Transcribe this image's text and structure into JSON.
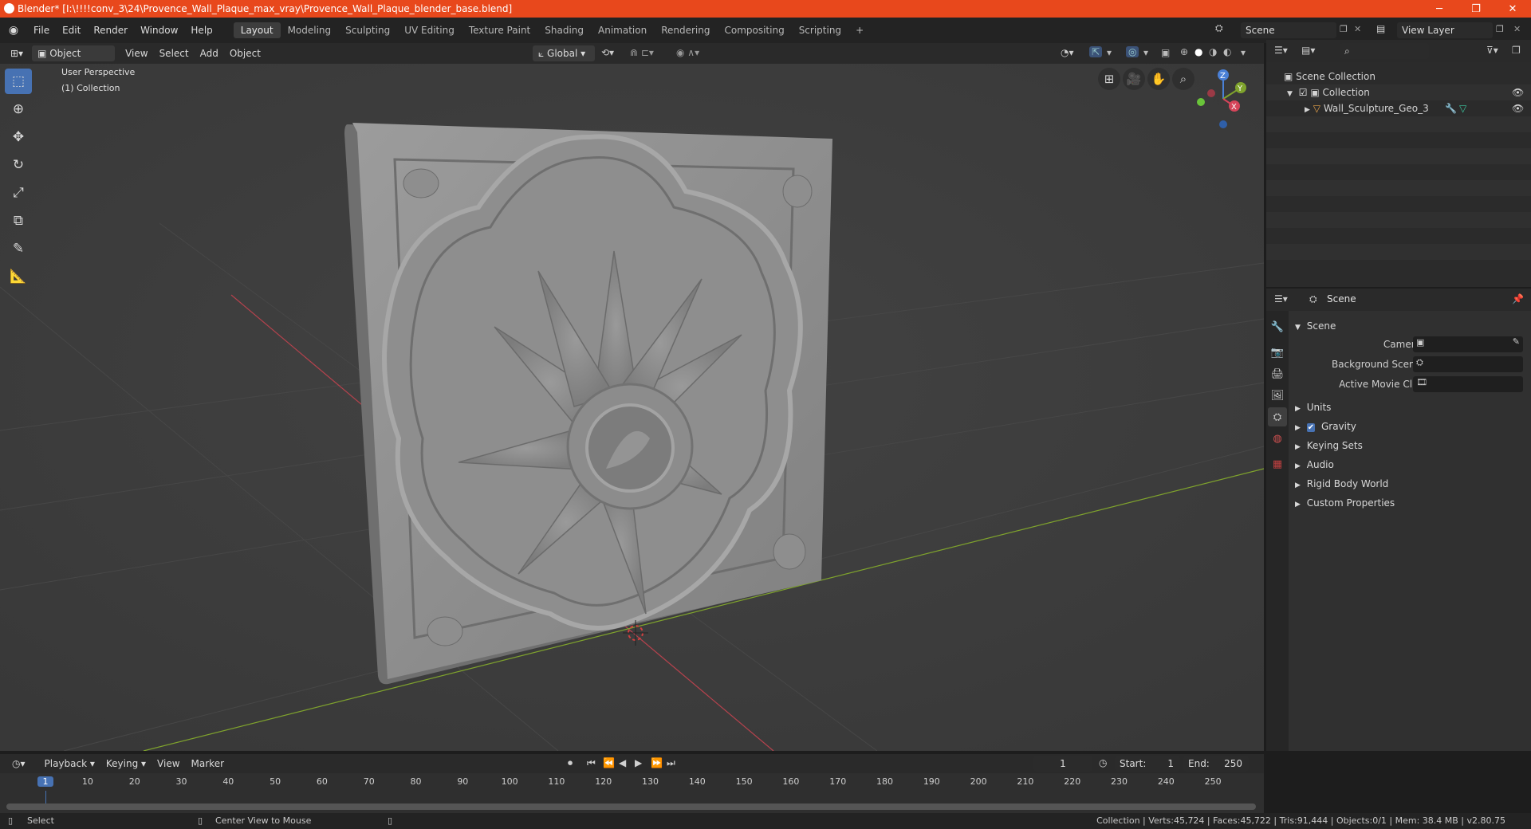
{
  "window": {
    "title": "Blender* [I:\\!!!!conv_3\\24\\Provence_Wall_Plaque_max_vray\\Provence_Wall_Plaque_blender_base.blend]",
    "minimize": "─",
    "maximize": "❐",
    "close": "✕"
  },
  "menu": [
    "File",
    "Edit",
    "Render",
    "Window",
    "Help"
  ],
  "workspaces": [
    "Layout",
    "Modeling",
    "Sculpting",
    "UV Editing",
    "Texture Paint",
    "Shading",
    "Animation",
    "Rendering",
    "Compositing",
    "Scripting"
  ],
  "workspace_add": "+",
  "scene_selector": "Scene",
  "viewlayer_selector": "View Layer",
  "viewport_header": {
    "mode": "Object Mode",
    "menus": [
      "View",
      "Select",
      "Add",
      "Object"
    ],
    "orientation": "Global"
  },
  "viewport": {
    "perspective": "User Perspective",
    "collection": "(1) Collection",
    "gizmo_x": "X",
    "gizmo_y": "Y",
    "gizmo_z": "Z"
  },
  "outliner": {
    "root": "Scene Collection",
    "collection": "Collection",
    "object": "Wall_Sculpture_Geo_3"
  },
  "properties": {
    "header": "Scene",
    "panel_title": "Scene",
    "camera_label": "Camera",
    "background_label": "Background Scene",
    "movieclip_label": "Active Movie Clip",
    "subpanels": [
      "Units",
      "Gravity",
      "Keying Sets",
      "Audio",
      "Rigid Body World",
      "Custom Properties"
    ]
  },
  "timeline": {
    "menus": [
      "Playback",
      "Keying",
      "View",
      "Marker"
    ],
    "current_frame": "1",
    "start_label": "Start:",
    "start_value": "1",
    "end_label": "End:",
    "end_value": "250",
    "ticks": [
      "1",
      "10",
      "20",
      "30",
      "40",
      "50",
      "60",
      "70",
      "80",
      "90",
      "100",
      "110",
      "120",
      "130",
      "140",
      "150",
      "160",
      "170",
      "180",
      "190",
      "200",
      "210",
      "220",
      "230",
      "240",
      "250"
    ]
  },
  "statusbar": {
    "left": "Select",
    "middle": "Center View to Mouse",
    "stats": "Collection | Verts:45,724 | Faces:45,722 | Tris:91,444 | Objects:0/1 | Mem: 38.4 MB | v2.80.75"
  },
  "colors": {
    "titlebar": "#e8481c",
    "accent": "#4772b3",
    "viewport_bg": "#3d3d3d",
    "x_axis": "#b5424d",
    "y_axis": "#7fa32d"
  }
}
